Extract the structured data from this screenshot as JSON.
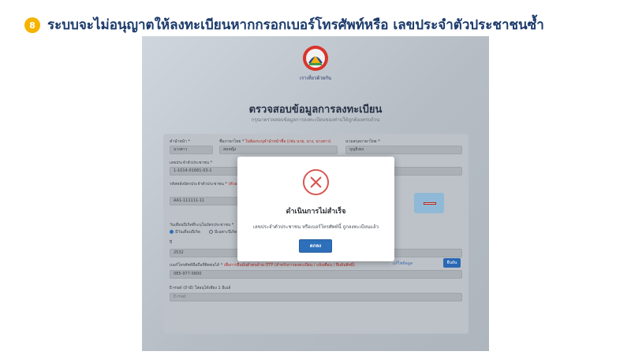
{
  "slide": {
    "step": "8",
    "title": "ระบบจะไม่อนุญาตให้ลงทะเบียนหากกรอกเบอร์โทรศัพท์หรือ เลขประจำตัวประชาชนซ้ำ"
  },
  "brand": {
    "logo_text": "เราเที่ยวด้วยกัน"
  },
  "page": {
    "title": "ตรวจสอบข้อมูลการลงทะเบียน",
    "subtitle": "กรุณาตรวจสอบข้อมูลการลงทะเบียนของท่านให้ถูกต้องครบถ้วน"
  },
  "form": {
    "title_label": "คำนำหน้า *",
    "title_value": "นางสาว",
    "firstname_label": "ชื่อภาษาไทย *",
    "firstname_note": "ไม่ต้องระบุคำนำหน้าชื่อ (เช่น นาย, นาง, นางสาว)",
    "firstname_value": "สมหญิง",
    "lastname_label": "นามสกุลภาษาไทย *",
    "lastname_value": "บุญยิ่งยง",
    "idcard_label": "เลขประจำตัวประชาชน *",
    "idcard_value": "1-1014-01681-03-1",
    "laser_label": "รหัสหลังบัตรประจำตัวประชาชน *",
    "laser_note": "(ตัวอย่าง)",
    "laser_value": "AA1-111111-11",
    "birth_label": "วันเดือนปีเกิดที่ระบุในบัตรประชาชน *",
    "birth_opt1": "มีวันเดือนปีเกิด",
    "birth_opt2": "มีเฉพาะปีเกิด",
    "year_label": "ปี",
    "year_value": "2532",
    "phone_label": "เบอร์โทรศัพท์มือถือที่ติดต่อได้ *",
    "phone_note": "เพื่อการยืนยันตัวตนด้วย OTP (สำหรับการลงทะเบียน / แจ้งเตือน / ยืนยันสิทธิ์)",
    "phone_value": "085-977-5600",
    "email_label": "E-mail (ถ้ามี) ใส่อนุได้เพียง 1 อีเมล์",
    "email_placeholder": "E-mail",
    "edit_link": "แก้ไขข้อมูล",
    "next_button": "ยืนยัน"
  },
  "dialog": {
    "title": "ดำเนินการไม่สำเร็จ",
    "message": "เลขประจำตัวประชาชน หรือเบอร์โทรศัพท์นี้ ถูกลงทะเบียนแล้ว",
    "ok_button": "ตกลง"
  },
  "colors": {
    "accent_yellow": "#f5b400",
    "title_navy": "#1b3a6b",
    "primary_blue": "#2e6fba",
    "error_red": "#d9534f"
  }
}
